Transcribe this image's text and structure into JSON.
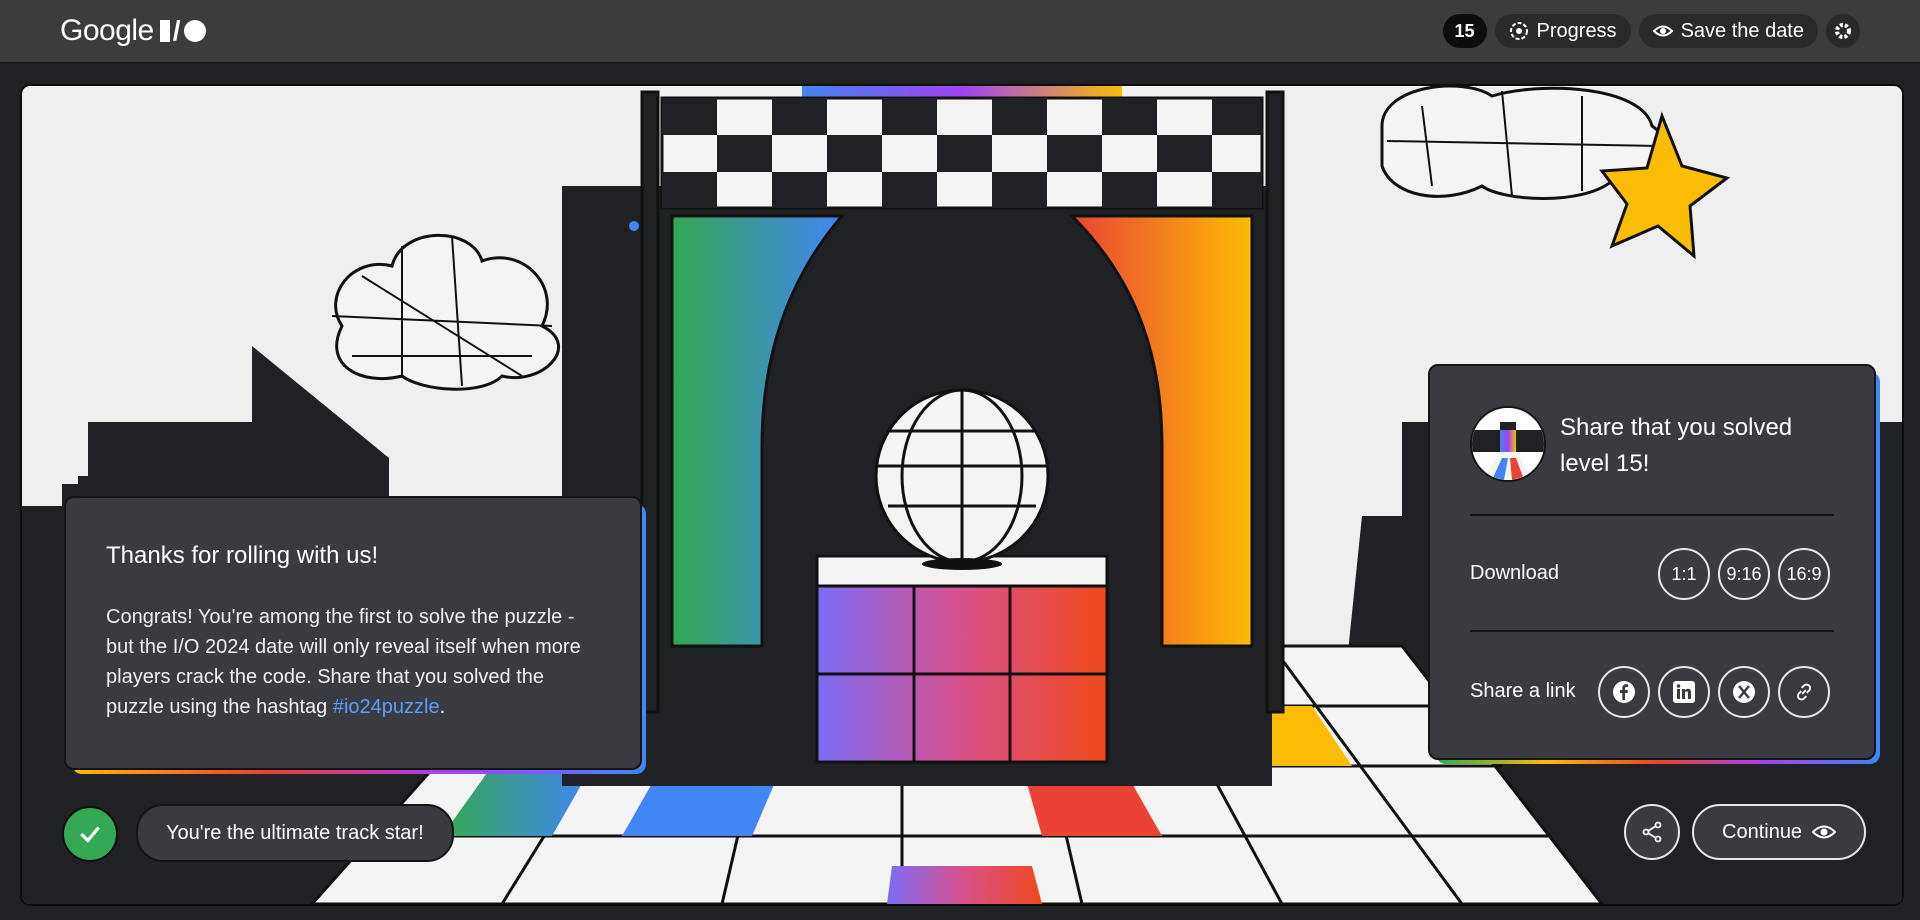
{
  "header": {
    "logo_text": "Google",
    "logo_mark": "I/O",
    "level": "15",
    "progress_label": "Progress",
    "save_date_label": "Save the date",
    "icons": {
      "progress": "target-icon",
      "save": "eye-icon",
      "settings": "gear-icon"
    }
  },
  "message": {
    "title": "Thanks for rolling with us!",
    "body": "Congrats! You're among the first to solve the puzzle - but the I/O 2024 date will only reveal itself when more players crack the code. Share that you solved the puzzle using the hashtag ",
    "hashtag": "#io24puzzle",
    "trailing": "."
  },
  "share": {
    "title": "Share that you solved level 15!",
    "download_label": "Download",
    "download_options": [
      "1:1",
      "9:16",
      "16:9"
    ],
    "share_link_label": "Share a link",
    "share_icons": [
      "facebook-icon",
      "linkedin-icon",
      "x-icon",
      "link-icon"
    ]
  },
  "footer": {
    "status": "You're the ultimate track star!",
    "continue_label": "Continue"
  },
  "colors": {
    "accent_green": "#34a853",
    "accent_blue": "#4285f4",
    "accent_red": "#ea4335",
    "accent_yellow": "#fbbc04",
    "hashtag": "#5d9cf8",
    "panel": "#3a3b40",
    "topbar": "#3c3c3f"
  }
}
